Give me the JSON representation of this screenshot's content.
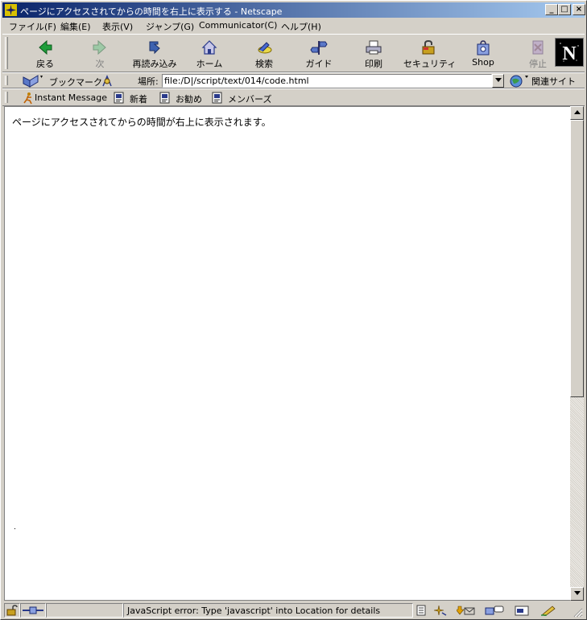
{
  "window": {
    "title": "ページにアクセスされてからの時間を右上に表示する - Netscape",
    "controls": {
      "minimize": "_",
      "maximize": "□",
      "close": "×"
    }
  },
  "menu": [
    {
      "label": "ファイル(F)"
    },
    {
      "label": "編集(E)"
    },
    {
      "label": "表示(V)"
    },
    {
      "label": "ジャンプ(G)"
    },
    {
      "label": "Communicator(C)"
    },
    {
      "label": "ヘルプ(H)"
    }
  ],
  "nav_toolbar": {
    "back": "戻る",
    "forward": "次",
    "reload": "再読み込み",
    "home": "ホーム",
    "search": "検索",
    "guide": "ガイド",
    "print": "印刷",
    "security": "セキュリティ",
    "shop": "Shop",
    "stop": "停止",
    "logo": "N"
  },
  "location_toolbar": {
    "bookmarks": "ブックマーク",
    "location_label": "場所:",
    "url": "file:/D|/script/text/014/code.html",
    "related": "関連サイト"
  },
  "personal_toolbar": {
    "instant_message": "Instant Message",
    "new": "新着",
    "recommended": "お勧め",
    "members": "メンバーズ"
  },
  "content": {
    "text": "ページにアクセスされてからの時間が右上に表示されます。"
  },
  "statusbar": {
    "message": "JavaScript error: Type 'javascript' into Location for details"
  },
  "colors": {
    "titlebar_start": "#0a246a",
    "titlebar_end": "#a6caf0",
    "chrome": "#d4d0c8"
  }
}
